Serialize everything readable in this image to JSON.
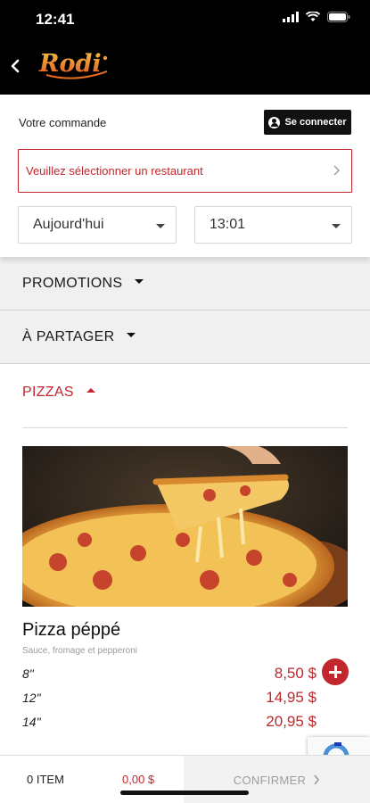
{
  "status_bar": {
    "time": "12:41"
  },
  "header": {
    "logo_text": "Rodi"
  },
  "order": {
    "label": "Votre commande",
    "login_label": "Se connecter",
    "restaurant_prompt": "Veuillez sélectionner un restaurant",
    "day_value": "Aujourd'hui",
    "time_value": "13:01"
  },
  "categories": [
    {
      "label": "PROMOTIONS",
      "expanded": false
    },
    {
      "label": "À PARTAGER",
      "expanded": false
    },
    {
      "label": "PIZZAS",
      "expanded": true
    }
  ],
  "product": {
    "name": "Pizza péppé",
    "description": "Sauce, fromage et pepperoni",
    "sizes": [
      {
        "size": "8\"",
        "price": "8,50 $"
      },
      {
        "size": "12\"",
        "price": "14,95 $"
      },
      {
        "size": "14\"",
        "price": "20,95 $"
      }
    ]
  },
  "cart": {
    "items": "0 ITEM",
    "total": "0,00 $",
    "confirm_label": "CONFIRMER"
  },
  "colors": {
    "accent": "#c1272d",
    "header_bg": "#000000",
    "category_bg": "#f0f0f0"
  }
}
